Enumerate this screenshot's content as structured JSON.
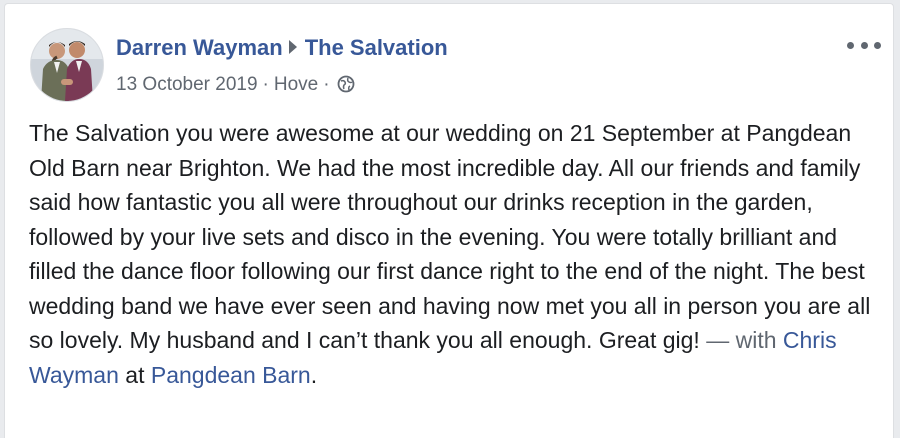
{
  "post": {
    "author": "Darren Wayman",
    "target": "The Salvation",
    "date": "13 October 2019",
    "location": "Hove",
    "separator": "·",
    "privacy_icon": "globe-icon",
    "more_icon": "more-options-icon",
    "body": "The Salvation you were awesome at our wedding on 21 September at Pangdean Old Barn near Brighton. We had the most incredible day. All our friends and family said how fantastic you all were throughout our drinks reception in the garden, followed by your live sets and disco in the evening. You were totally brilliant and filled the dance floor following our first dance right to the end of the night. The best wedding band we have ever seen and having now met you all in person you are all so lovely. My husband and I can’t thank you all enough. Great gig!",
    "with_text": "— with",
    "tagged_person": "Chris Wayman",
    "at_text": "at",
    "place": "Pangdean Barn",
    "end_punct": "."
  },
  "colors": {
    "link": "#385898",
    "text": "#1c1e21",
    "muted": "#606770",
    "background": "#e9ebee",
    "card": "#ffffff"
  }
}
